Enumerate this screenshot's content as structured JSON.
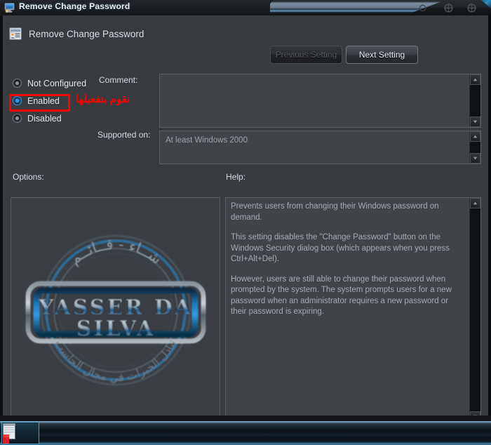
{
  "window": {
    "title": "Remove Change Password",
    "icon": "computer-monitor-icon",
    "controls": {
      "minimize_label": "minimize-icon",
      "maximize_label": "maximize-icon",
      "close_label": "close-icon"
    }
  },
  "dialog": {
    "header_icon": "group-policy-setting-icon",
    "header_title": "Remove Change Password",
    "nav": {
      "previous_label": "Previous Setting",
      "previous_enabled": false,
      "next_label": "Next Setting",
      "next_enabled": true
    },
    "state_options": [
      {
        "label": "Not Configured",
        "selected": false
      },
      {
        "label": "Enabled",
        "selected": true
      },
      {
        "label": "Disabled",
        "selected": false
      }
    ],
    "annotation": {
      "arabic_note": "نقوم بتفعيلها",
      "highlight_color": "#ff0000",
      "note_color": "#fe0000",
      "highlights_option": "Enabled"
    },
    "fields": {
      "comment_label": "Comment:",
      "comment_value": "",
      "supported_label": "Supported on:",
      "supported_value": "At least Windows 2000"
    },
    "options_label": "Options:",
    "help_label": "Help:",
    "help_paragraphs": [
      "Prevents users from changing their Windows password on demand.",
      "This setting disables the \"Change Password\" button on the Windows Security dialog box (which appears when you press Ctrl+Alt+Del).",
      "However, users are still able to change their password when prompted by the system. The system prompts users for a new password when an administrator requires a new password or their password is expiring."
    ],
    "watermark": {
      "name_line1": "YASSER DA",
      "name_line2": "SILVA",
      "arabic_top": "شــاء - قــائــم",
      "arabic_bottom": "تبادل الخبرات في مجال الحاسب"
    }
  },
  "taskbar": {
    "item_icon": "window-thumbnail-icon"
  },
  "colors": {
    "window_background": "#383b40",
    "inset_background": "#404449",
    "inset_border": "#5a5f66",
    "text_primary": "#dfe4ea",
    "text_secondary": "#a3aab2",
    "accent_blue": "#2e9ae8",
    "annotation_red": "#ff0000",
    "titlebar_dark": "#1b1e22",
    "taskbar_accent": "#4aa0cc"
  }
}
